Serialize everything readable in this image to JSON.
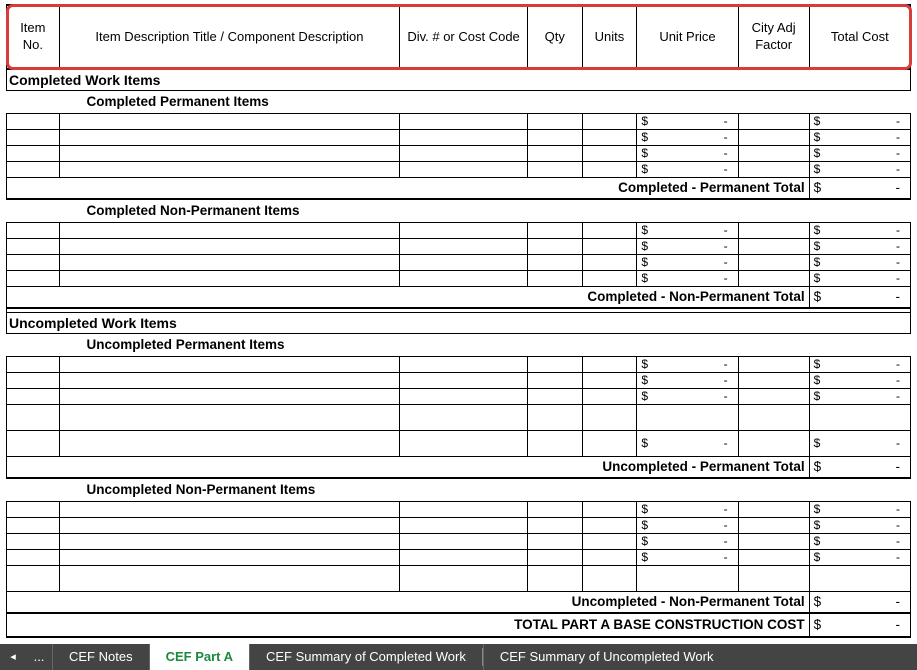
{
  "headers": {
    "item_no": "Item No.",
    "desc": "Item Description Title / Component Description",
    "div": "Div. # or Cost Code",
    "qty": "Qty",
    "units": "Units",
    "unit_price": "Unit Price",
    "city_adj": "City Adj Factor",
    "total_cost": "Total Cost"
  },
  "sections": {
    "completed": {
      "title": "Completed Work Items",
      "permanent": {
        "title": "Completed Permanent Items",
        "rows": [
          {
            "unit_price_sym": "$",
            "unit_price_val": "-",
            "total_sym": "$",
            "total_val": "-"
          },
          {
            "unit_price_sym": "$",
            "unit_price_val": "-",
            "total_sym": "$",
            "total_val": "-"
          },
          {
            "unit_price_sym": "$",
            "unit_price_val": "-",
            "total_sym": "$",
            "total_val": "-"
          },
          {
            "unit_price_sym": "$",
            "unit_price_val": "-",
            "total_sym": "$",
            "total_val": "-"
          }
        ],
        "subtotal_label": "Completed - Permanent Total",
        "subtotal_sym": "$",
        "subtotal_val": "-"
      },
      "nonpermanent": {
        "title": "Completed Non-Permanent Items",
        "rows": [
          {
            "unit_price_sym": "$",
            "unit_price_val": "-",
            "total_sym": "$",
            "total_val": "-"
          },
          {
            "unit_price_sym": "$",
            "unit_price_val": "-",
            "total_sym": "$",
            "total_val": "-"
          },
          {
            "unit_price_sym": "$",
            "unit_price_val": "-",
            "total_sym": "$",
            "total_val": "-"
          },
          {
            "unit_price_sym": "$",
            "unit_price_val": "-",
            "total_sym": "$",
            "total_val": "-"
          }
        ],
        "subtotal_label": "Completed - Non-Permanent Total",
        "subtotal_sym": "$",
        "subtotal_val": "-"
      }
    },
    "uncompleted": {
      "title": "Uncompleted Work Items",
      "permanent": {
        "title": "Uncompleted Permanent Items",
        "rows": [
          {
            "unit_price_sym": "$",
            "unit_price_val": "-",
            "total_sym": "$",
            "total_val": "-"
          },
          {
            "unit_price_sym": "$",
            "unit_price_val": "-",
            "total_sym": "$",
            "total_val": "-"
          },
          {
            "unit_price_sym": "$",
            "unit_price_val": "-",
            "total_sym": "$",
            "total_val": "-"
          },
          {
            "unit_price_sym": "",
            "unit_price_val": "",
            "total_sym": "",
            "total_val": ""
          },
          {
            "unit_price_sym": "$",
            "unit_price_val": "-",
            "total_sym": "$",
            "total_val": "-"
          }
        ],
        "subtotal_label": "Uncompleted - Permanent Total",
        "subtotal_sym": "$",
        "subtotal_val": "-"
      },
      "nonpermanent": {
        "title": "Uncompleted Non-Permanent Items",
        "rows": [
          {
            "unit_price_sym": "$",
            "unit_price_val": "-",
            "total_sym": "$",
            "total_val": "-"
          },
          {
            "unit_price_sym": "$",
            "unit_price_val": "-",
            "total_sym": "$",
            "total_val": "-"
          },
          {
            "unit_price_sym": "$",
            "unit_price_val": "-",
            "total_sym": "$",
            "total_val": "-"
          },
          {
            "unit_price_sym": "$",
            "unit_price_val": "-",
            "total_sym": "$",
            "total_val": "-"
          },
          {
            "unit_price_sym": "",
            "unit_price_val": "",
            "total_sym": "",
            "total_val": ""
          }
        ],
        "subtotal_label": "Uncompleted - Non-Permanent Total",
        "subtotal_sym": "$",
        "subtotal_val": "-"
      }
    }
  },
  "grand_total": {
    "label": "TOTAL PART A BASE CONSTRUCTION COST",
    "sym": "$",
    "val": "-"
  },
  "tabs": {
    "nav_prev": "◂",
    "dots": "...",
    "items": [
      {
        "label": "CEF Notes",
        "active": false
      },
      {
        "label": "CEF Part A",
        "active": true
      },
      {
        "label": "CEF Summary of Completed Work",
        "active": false
      },
      {
        "label": "CEF Summary of Uncompleted Work",
        "active": false
      }
    ]
  }
}
